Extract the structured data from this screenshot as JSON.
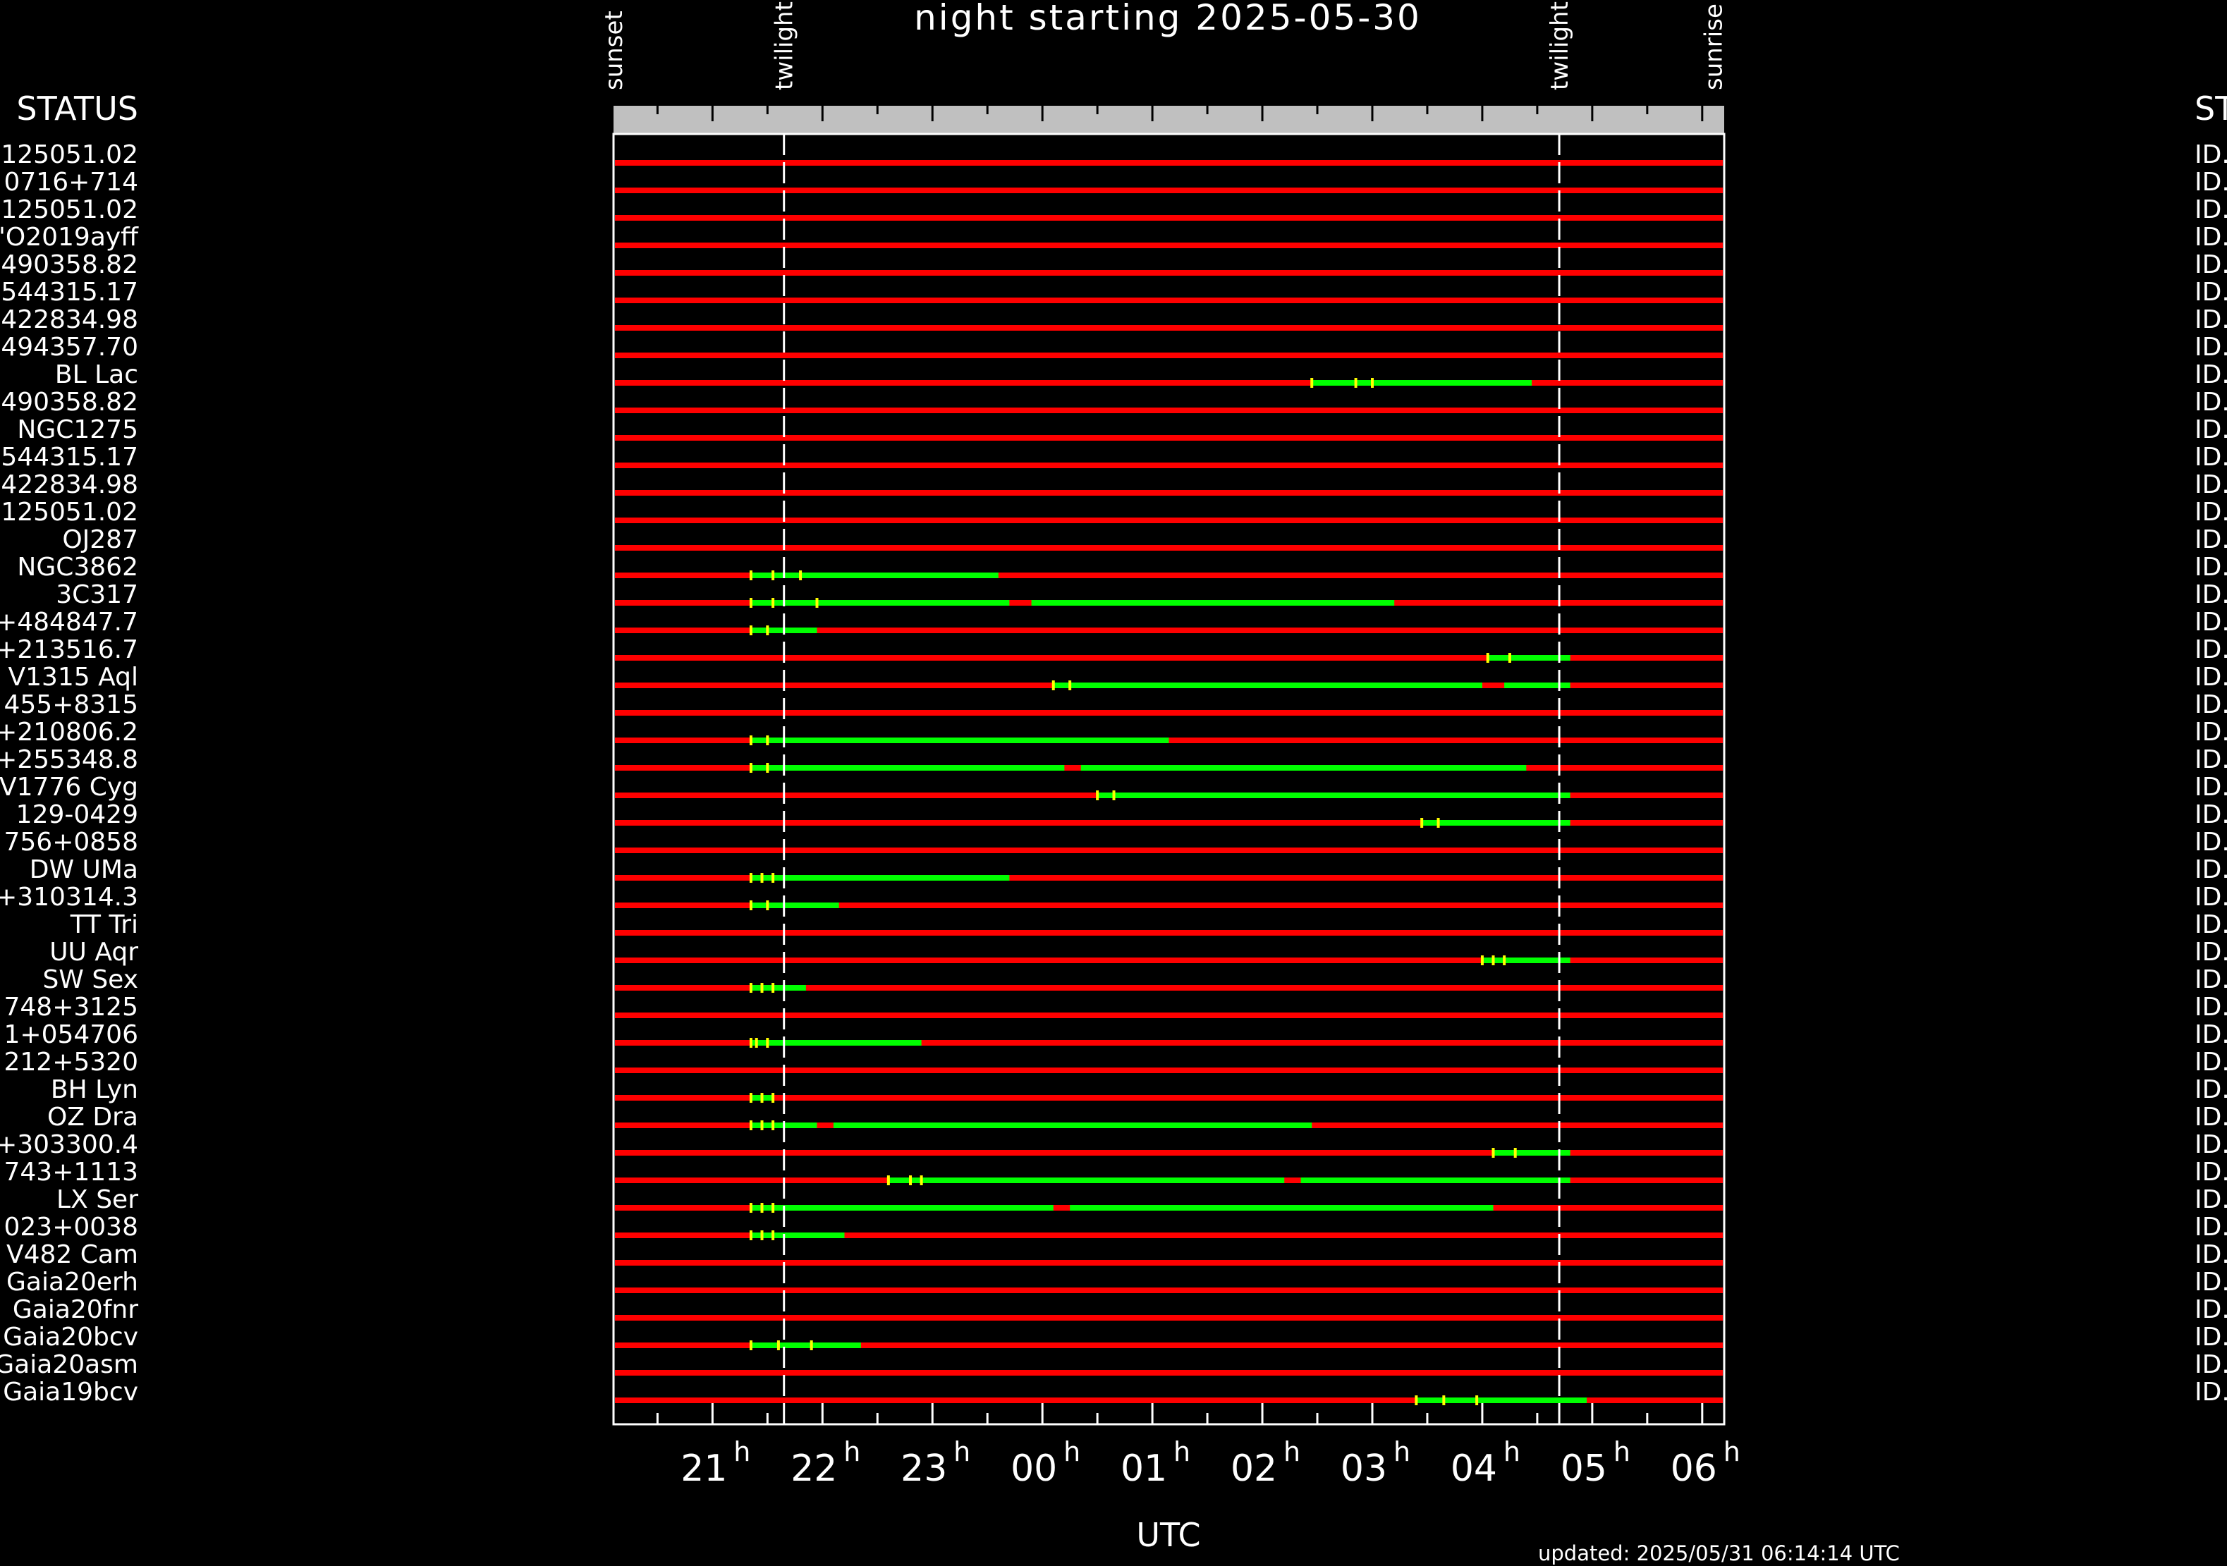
{
  "chart_data": {
    "type": "timeline",
    "title": "night starting 2025-05-30",
    "xlabel": "UTC",
    "footer": "updated: 2025/05/31 06:14:14 UTC",
    "left_header": "STATUS",
    "right_header": "ST",
    "right_value": "ID.",
    "time_range_h": [
      20.1,
      30.2
    ],
    "tick_labels": [
      {
        "h": 21,
        "main": "21",
        "sup": "h"
      },
      {
        "h": 22,
        "main": "22",
        "sup": "h"
      },
      {
        "h": 23,
        "main": "23",
        "sup": "h"
      },
      {
        "h": 24,
        "main": "00",
        "sup": "h"
      },
      {
        "h": 25,
        "main": "01",
        "sup": "h"
      },
      {
        "h": 26,
        "main": "02",
        "sup": "h"
      },
      {
        "h": 27,
        "main": "03",
        "sup": "h"
      },
      {
        "h": 28,
        "main": "04",
        "sup": "h"
      },
      {
        "h": 29,
        "main": "05",
        "sup": "h"
      },
      {
        "h": 30,
        "main": "06",
        "sup": "h"
      }
    ],
    "events": [
      {
        "label": "sunset",
        "h": 20.1
      },
      {
        "label": "twilight",
        "h": 21.65
      },
      {
        "label": "twilight",
        "h": 28.7
      },
      {
        "label": "sunrise",
        "h": 30.1
      }
    ],
    "twilight_lines_h": [
      21.65,
      28.7
    ],
    "colors": {
      "unobservable": "#ff0000",
      "observable": "#00ff00",
      "marker": "#ffff00",
      "header_bar": "#c0c0c0"
    },
    "rows": [
      {
        "name": "125051.02",
        "segments": [],
        "markers": []
      },
      {
        "name": "0716+714",
        "segments": [],
        "markers": []
      },
      {
        "name": "125051.02",
        "segments": [],
        "markers": []
      },
      {
        "name": "'O2019ayff",
        "segments": [],
        "markers": []
      },
      {
        "name": "490358.82",
        "segments": [],
        "markers": []
      },
      {
        "name": "544315.17",
        "segments": [],
        "markers": []
      },
      {
        "name": "422834.98",
        "segments": [],
        "markers": []
      },
      {
        "name": "494357.70",
        "segments": [],
        "markers": []
      },
      {
        "name": "BL Lac",
        "segments": [
          [
            26.45,
            28.45
          ]
        ],
        "markers": [
          26.45,
          26.85,
          27.0
        ]
      },
      {
        "name": "490358.82",
        "segments": [],
        "markers": []
      },
      {
        "name": "NGC1275",
        "segments": [],
        "markers": []
      },
      {
        "name": "544315.17",
        "segments": [],
        "markers": []
      },
      {
        "name": "422834.98",
        "segments": [],
        "markers": []
      },
      {
        "name": "125051.02",
        "segments": [],
        "markers": []
      },
      {
        "name": "OJ287",
        "segments": [],
        "markers": []
      },
      {
        "name": "NGC3862",
        "segments": [
          [
            21.35,
            23.6
          ]
        ],
        "markers": [
          21.35,
          21.55,
          21.8
        ]
      },
      {
        "name": "3C317",
        "segments": [
          [
            21.35,
            23.7
          ],
          [
            23.9,
            27.2
          ]
        ],
        "markers": [
          21.35,
          21.55,
          21.95
        ]
      },
      {
        "name": "+484847.7",
        "segments": [
          [
            21.35,
            21.95
          ]
        ],
        "markers": [
          21.35,
          21.5
        ]
      },
      {
        "name": "+213516.7",
        "segments": [
          [
            28.05,
            28.8
          ]
        ],
        "markers": [
          28.05,
          28.25
        ]
      },
      {
        "name": "V1315 Aql",
        "segments": [
          [
            24.1,
            28.0
          ],
          [
            28.2,
            28.8
          ]
        ],
        "markers": [
          24.1,
          24.25
        ]
      },
      {
        "name": "455+8315",
        "segments": [],
        "markers": []
      },
      {
        "name": "+210806.2",
        "segments": [
          [
            21.35,
            25.15
          ]
        ],
        "markers": [
          21.35,
          21.5
        ]
      },
      {
        "name": "+255348.8",
        "segments": [
          [
            21.35,
            24.2
          ],
          [
            24.35,
            28.4
          ]
        ],
        "markers": [
          21.35,
          21.5
        ]
      },
      {
        "name": "V1776 Cyg",
        "segments": [
          [
            24.5,
            28.8
          ]
        ],
        "markers": [
          24.5,
          24.65
        ]
      },
      {
        "name": "129-0429",
        "segments": [
          [
            27.45,
            28.8
          ]
        ],
        "markers": [
          27.45,
          27.6
        ]
      },
      {
        "name": "756+0858",
        "segments": [],
        "markers": []
      },
      {
        "name": "DW UMa",
        "segments": [
          [
            21.35,
            23.7
          ]
        ],
        "markers": [
          21.35,
          21.45,
          21.55
        ]
      },
      {
        "name": "+310314.3",
        "segments": [
          [
            21.35,
            22.15
          ]
        ],
        "markers": [
          21.35,
          21.5
        ]
      },
      {
        "name": "TT Tri",
        "segments": [],
        "markers": []
      },
      {
        "name": "UU Aqr",
        "segments": [
          [
            28.0,
            28.8
          ]
        ],
        "markers": [
          28.0,
          28.1,
          28.2
        ]
      },
      {
        "name": "SW Sex",
        "segments": [
          [
            21.35,
            21.85
          ]
        ],
        "markers": [
          21.35,
          21.45,
          21.55
        ]
      },
      {
        "name": "748+3125",
        "segments": [],
        "markers": []
      },
      {
        "name": "1+054706",
        "segments": [
          [
            21.35,
            22.9
          ]
        ],
        "markers": [
          21.35,
          21.4,
          21.5
        ]
      },
      {
        "name": "212+5320",
        "segments": [],
        "markers": []
      },
      {
        "name": "BH Lyn",
        "segments": [
          [
            21.35,
            21.55
          ]
        ],
        "markers": [
          21.35,
          21.45,
          21.55
        ]
      },
      {
        "name": "OZ Dra",
        "segments": [
          [
            21.35,
            21.95
          ],
          [
            22.1,
            26.45
          ]
        ],
        "markers": [
          21.35,
          21.45,
          21.55
        ]
      },
      {
        "name": "+303300.4",
        "segments": [
          [
            28.1,
            28.8
          ]
        ],
        "markers": [
          28.1,
          28.3
        ]
      },
      {
        "name": "743+1113",
        "segments": [
          [
            22.6,
            26.2
          ],
          [
            26.35,
            28.8
          ]
        ],
        "markers": [
          22.6,
          22.8,
          22.9
        ]
      },
      {
        "name": "LX Ser",
        "segments": [
          [
            21.35,
            24.1
          ],
          [
            24.25,
            28.1
          ]
        ],
        "markers": [
          21.35,
          21.45,
          21.55
        ]
      },
      {
        "name": "023+0038",
        "segments": [
          [
            21.35,
            22.2
          ]
        ],
        "markers": [
          21.35,
          21.45,
          21.55
        ]
      },
      {
        "name": "V482 Cam",
        "segments": [],
        "markers": []
      },
      {
        "name": "Gaia20erh",
        "segments": [],
        "markers": []
      },
      {
        "name": "Gaia20fnr",
        "segments": [],
        "markers": []
      },
      {
        "name": "Gaia20bcv",
        "segments": [
          [
            21.35,
            22.35
          ]
        ],
        "markers": [
          21.35,
          21.6,
          21.9
        ]
      },
      {
        "name": "Gaia20asm",
        "segments": [],
        "markers": []
      },
      {
        "name": "Gaia19bcv",
        "segments": [
          [
            27.4,
            28.95
          ]
        ],
        "markers": [
          27.4,
          27.65,
          27.95
        ]
      }
    ]
  }
}
